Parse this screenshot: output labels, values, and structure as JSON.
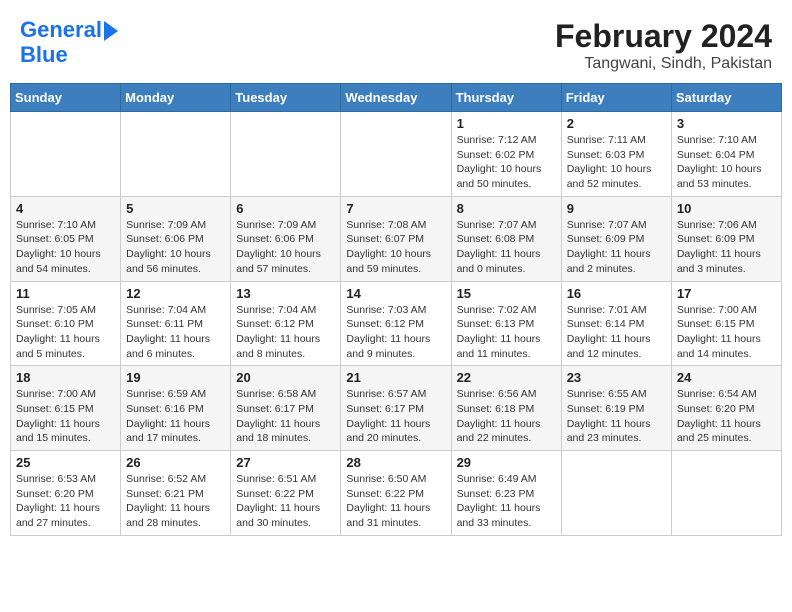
{
  "header": {
    "logo_line1": "General",
    "logo_line2": "Blue",
    "title": "February 2024",
    "subtitle": "Tangwani, Sindh, Pakistan"
  },
  "calendar": {
    "days_of_week": [
      "Sunday",
      "Monday",
      "Tuesday",
      "Wednesday",
      "Thursday",
      "Friday",
      "Saturday"
    ],
    "weeks": [
      [
        {
          "day": "",
          "info": ""
        },
        {
          "day": "",
          "info": ""
        },
        {
          "day": "",
          "info": ""
        },
        {
          "day": "",
          "info": ""
        },
        {
          "day": "1",
          "info": "Sunrise: 7:12 AM\nSunset: 6:02 PM\nDaylight: 10 hours\nand 50 minutes."
        },
        {
          "day": "2",
          "info": "Sunrise: 7:11 AM\nSunset: 6:03 PM\nDaylight: 10 hours\nand 52 minutes."
        },
        {
          "day": "3",
          "info": "Sunrise: 7:10 AM\nSunset: 6:04 PM\nDaylight: 10 hours\nand 53 minutes."
        }
      ],
      [
        {
          "day": "4",
          "info": "Sunrise: 7:10 AM\nSunset: 6:05 PM\nDaylight: 10 hours\nand 54 minutes."
        },
        {
          "day": "5",
          "info": "Sunrise: 7:09 AM\nSunset: 6:06 PM\nDaylight: 10 hours\nand 56 minutes."
        },
        {
          "day": "6",
          "info": "Sunrise: 7:09 AM\nSunset: 6:06 PM\nDaylight: 10 hours\nand 57 minutes."
        },
        {
          "day": "7",
          "info": "Sunrise: 7:08 AM\nSunset: 6:07 PM\nDaylight: 10 hours\nand 59 minutes."
        },
        {
          "day": "8",
          "info": "Sunrise: 7:07 AM\nSunset: 6:08 PM\nDaylight: 11 hours\nand 0 minutes."
        },
        {
          "day": "9",
          "info": "Sunrise: 7:07 AM\nSunset: 6:09 PM\nDaylight: 11 hours\nand 2 minutes."
        },
        {
          "day": "10",
          "info": "Sunrise: 7:06 AM\nSunset: 6:09 PM\nDaylight: 11 hours\nand 3 minutes."
        }
      ],
      [
        {
          "day": "11",
          "info": "Sunrise: 7:05 AM\nSunset: 6:10 PM\nDaylight: 11 hours\nand 5 minutes."
        },
        {
          "day": "12",
          "info": "Sunrise: 7:04 AM\nSunset: 6:11 PM\nDaylight: 11 hours\nand 6 minutes."
        },
        {
          "day": "13",
          "info": "Sunrise: 7:04 AM\nSunset: 6:12 PM\nDaylight: 11 hours\nand 8 minutes."
        },
        {
          "day": "14",
          "info": "Sunrise: 7:03 AM\nSunset: 6:12 PM\nDaylight: 11 hours\nand 9 minutes."
        },
        {
          "day": "15",
          "info": "Sunrise: 7:02 AM\nSunset: 6:13 PM\nDaylight: 11 hours\nand 11 minutes."
        },
        {
          "day": "16",
          "info": "Sunrise: 7:01 AM\nSunset: 6:14 PM\nDaylight: 11 hours\nand 12 minutes."
        },
        {
          "day": "17",
          "info": "Sunrise: 7:00 AM\nSunset: 6:15 PM\nDaylight: 11 hours\nand 14 minutes."
        }
      ],
      [
        {
          "day": "18",
          "info": "Sunrise: 7:00 AM\nSunset: 6:15 PM\nDaylight: 11 hours\nand 15 minutes."
        },
        {
          "day": "19",
          "info": "Sunrise: 6:59 AM\nSunset: 6:16 PM\nDaylight: 11 hours\nand 17 minutes."
        },
        {
          "day": "20",
          "info": "Sunrise: 6:58 AM\nSunset: 6:17 PM\nDaylight: 11 hours\nand 18 minutes."
        },
        {
          "day": "21",
          "info": "Sunrise: 6:57 AM\nSunset: 6:17 PM\nDaylight: 11 hours\nand 20 minutes."
        },
        {
          "day": "22",
          "info": "Sunrise: 6:56 AM\nSunset: 6:18 PM\nDaylight: 11 hours\nand 22 minutes."
        },
        {
          "day": "23",
          "info": "Sunrise: 6:55 AM\nSunset: 6:19 PM\nDaylight: 11 hours\nand 23 minutes."
        },
        {
          "day": "24",
          "info": "Sunrise: 6:54 AM\nSunset: 6:20 PM\nDaylight: 11 hours\nand 25 minutes."
        }
      ],
      [
        {
          "day": "25",
          "info": "Sunrise: 6:53 AM\nSunset: 6:20 PM\nDaylight: 11 hours\nand 27 minutes."
        },
        {
          "day": "26",
          "info": "Sunrise: 6:52 AM\nSunset: 6:21 PM\nDaylight: 11 hours\nand 28 minutes."
        },
        {
          "day": "27",
          "info": "Sunrise: 6:51 AM\nSunset: 6:22 PM\nDaylight: 11 hours\nand 30 minutes."
        },
        {
          "day": "28",
          "info": "Sunrise: 6:50 AM\nSunset: 6:22 PM\nDaylight: 11 hours\nand 31 minutes."
        },
        {
          "day": "29",
          "info": "Sunrise: 6:49 AM\nSunset: 6:23 PM\nDaylight: 11 hours\nand 33 minutes."
        },
        {
          "day": "",
          "info": ""
        },
        {
          "day": "",
          "info": ""
        }
      ]
    ]
  }
}
